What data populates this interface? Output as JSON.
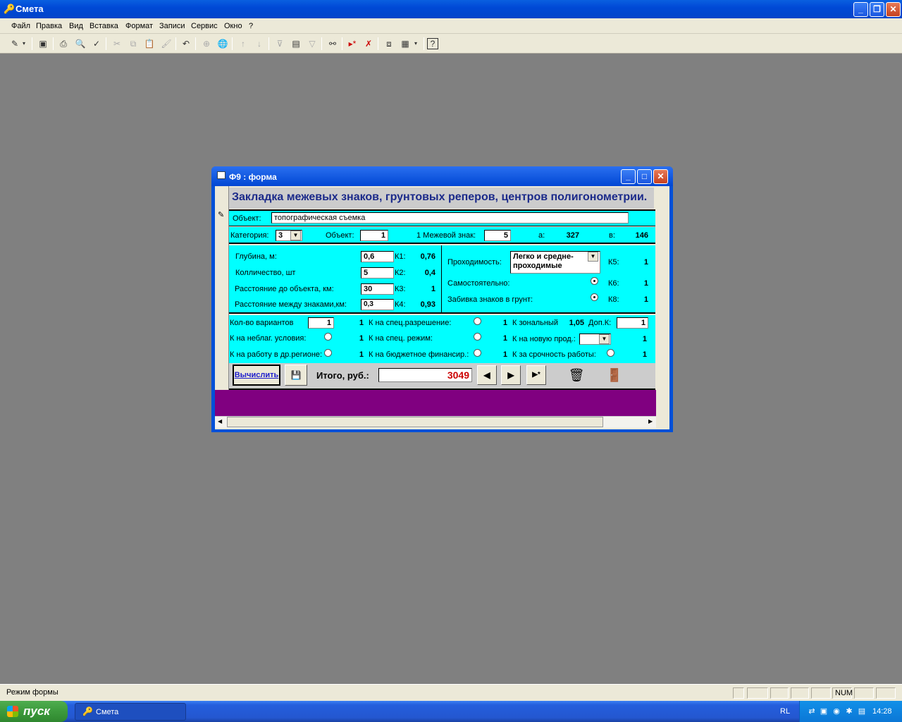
{
  "app": {
    "title": "Смета"
  },
  "menu": [
    "Файл",
    "Правка",
    "Вид",
    "Вставка",
    "Формат",
    "Записи",
    "Сервис",
    "Окно",
    "?"
  ],
  "toolbar_icons": [
    "design-view-icon",
    "save-icon",
    "print-icon",
    "print-preview-icon",
    "spelling-icon",
    "cut-icon",
    "copy-icon",
    "paste-icon",
    "format-painter-icon",
    "undo-icon",
    "hyperlink-icon",
    "web-toolbar-icon",
    "sort-ascending-icon",
    "sort-descending-icon",
    "filter-by-selection-icon",
    "filter-by-form-icon",
    "apply-filter-icon",
    "find-icon",
    "new-record-icon",
    "delete-record-icon",
    "database-window-icon",
    "new-object-icon",
    "help-icon"
  ],
  "form": {
    "window_title": "Ф9 : форма",
    "header": "Закладка межевых знаков, грунтовых реперов, центров полигонометрии.",
    "object_label": "Объект:",
    "object_value": "топографическая съемка",
    "category_label": "Категория:",
    "category_value": "3",
    "object_count_label": "Объект:",
    "object_count_value": "1",
    "mark_label": "1 Межевой знак:",
    "mark_value": "5",
    "a_label": "а:",
    "a_value": "327",
    "v_label": "в:",
    "v_value": "146",
    "depth_label": "Глубина, м:",
    "depth_value": "0,6",
    "k1_label": "К1:",
    "k1_value": "0,76",
    "qty_label": "Колличество, шт",
    "qty_value": "5",
    "k2_label": "К2:",
    "k2_value": "0,4",
    "dist_label": "Расстояние до объекта, км:",
    "dist_value": "30",
    "k3_label": "К3:",
    "k3_value": "1",
    "between_label": "Расстояние между знаками,км:",
    "between_value": "0,3",
    "k4_label": "К4:",
    "k4_value": "0,93",
    "pass_label": "Проходимость:",
    "pass_value": "Легко и средне-проходимые",
    "k5_label": "К5:",
    "k5_value": "1",
    "self_label": "Самостоятельно:",
    "k6_label": "К6:",
    "k6_value": "1",
    "drive_label": "Забивка знаков  в  грунт:",
    "k8_label": "К8:",
    "k8_value": "1",
    "variants_label": "Кол-во вариантов",
    "variants_value": "1",
    "variants_k": "1",
    "spec_perm_label": "К на спец.разрешение:",
    "spec_perm_k": "1",
    "zonal_label": "К зональный",
    "zonal_value": "1,05",
    "extra_label": "Доп.К:",
    "extra_value": "1",
    "adverse_label": "К на неблаг. условия:",
    "adverse_k": "1",
    "spec_mode_label": "К на спец. режим:",
    "spec_mode_k": "1",
    "new_prod_label": "К на новую прод.:",
    "new_prod_k": "1",
    "region_label": "К на работу в др.регионе:",
    "region_k": "1",
    "budget_label": "К на бюджетное финансир.:",
    "budget_k": "1",
    "urgent_label": "К за срочность работы:",
    "urgent_k": "1",
    "calc_button": "Вычислить",
    "total_label": "Итого, руб.:",
    "total_value": "3049"
  },
  "status": {
    "mode": "Режим формы",
    "num": "NUM"
  },
  "taskbar": {
    "start": "пуск",
    "task": "Смета",
    "lang": "RL",
    "clock": "14:28"
  },
  "colors": {
    "form_bg": "#00ffff",
    "header_text": "#1b2a8a",
    "total_text": "#cc0000",
    "footer": "#800080"
  }
}
